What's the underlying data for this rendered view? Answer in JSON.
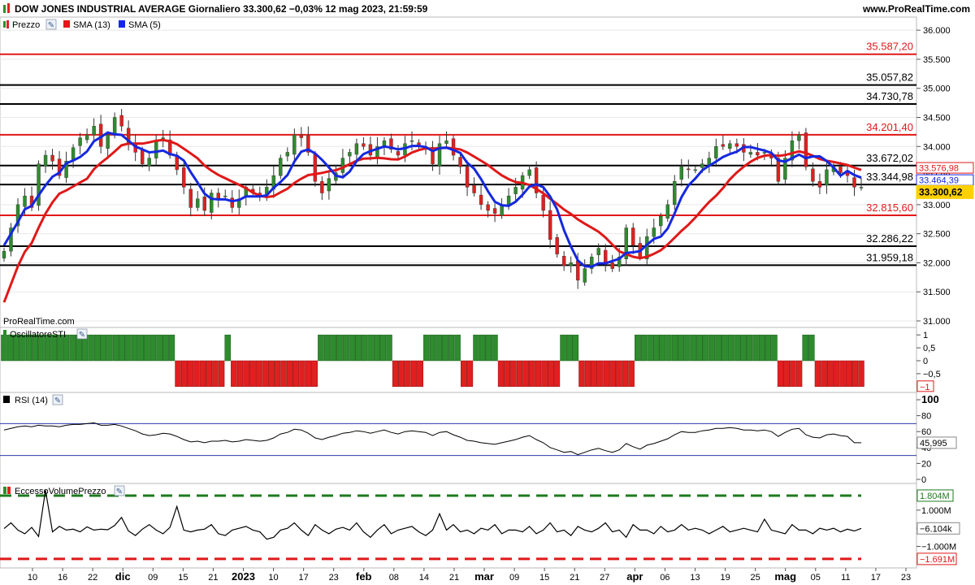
{
  "header": {
    "title": "DOW JONES INDUSTRIAL AVERAGE Giornaliero 33.300,62 −0,03% 12 mag 2023, 21:59:59",
    "site": "www.ProRealTime.com"
  },
  "legend": {
    "price": "Prezzo",
    "sma13": "SMA (13)",
    "sma5": "SMA (5)"
  },
  "watermark": "ProRealTime.com",
  "colors": {
    "up": "#2e8b2e",
    "down": "#e02020",
    "sma13": "#e01818",
    "sma5": "#1428e0",
    "grid": "#e8e8e8"
  },
  "chart_data": [
    {
      "type": "candlestick",
      "name": "price-panel",
      "ylim": [
        31000,
        36100
      ],
      "y_ticks": [
        "36.000",
        "35.500",
        "35.000",
        "34.500",
        "34.000",
        "33.500",
        "33.000",
        "32.500",
        "32.000",
        "31.500",
        "31.000"
      ],
      "y_tick_values": [
        36000,
        35500,
        35000,
        34500,
        34000,
        33500,
        33000,
        32500,
        32000,
        31500,
        31000
      ],
      "x_tick_labels": [
        "10",
        "16",
        "22",
        "dic",
        "09",
        "15",
        "21",
        "2023",
        "10",
        "17",
        "23",
        "feb",
        "08",
        "14",
        "21",
        "mar",
        "09",
        "15",
        "21",
        "27",
        "apr",
        "06",
        "13",
        "19",
        "25",
        "mag",
        "05",
        "11",
        "17",
        "23"
      ],
      "levels": [
        {
          "value": 35587.2,
          "label": "35.587,20",
          "color": "#e01818"
        },
        {
          "value": 35057.82,
          "label": "35.057,82",
          "color": "#000000"
        },
        {
          "value": 34730.78,
          "label": "34.730,78",
          "color": "#000000"
        },
        {
          "value": 34201.4,
          "label": "34.201,40",
          "color": "#e01818"
        },
        {
          "value": 33672.02,
          "label": "33.672,02",
          "color": "#000000"
        },
        {
          "value": 33344.98,
          "label": "33.344,98",
          "color": "#000000"
        },
        {
          "value": 32815.6,
          "label": "32.815,60",
          "color": "#e01818"
        },
        {
          "value": 32286.22,
          "label": "32.286,22",
          "color": "#000000"
        },
        {
          "value": 31959.18,
          "label": "31.959,18",
          "color": "#000000"
        }
      ],
      "badges": [
        {
          "value": 33576.98,
          "label": "33.576,98",
          "kind": "sma13"
        },
        {
          "value": 33464.39,
          "label": "33.464,39",
          "kind": "sma5"
        },
        {
          "value": 33300.62,
          "label": "33.300,62",
          "kind": "last"
        }
      ],
      "close": [
        32200,
        32600,
        33000,
        33150,
        32950,
        33700,
        33850,
        33750,
        33500,
        33750,
        33980,
        34150,
        34200,
        34350,
        34000,
        34200,
        34500,
        34350,
        34050,
        33900,
        33700,
        33800,
        34100,
        34150,
        33850,
        33600,
        33300,
        32950,
        33100,
        32900,
        33200,
        33100,
        33150,
        32950,
        33100,
        33300,
        33200,
        33150,
        33300,
        33500,
        33800,
        33900,
        34200,
        34150,
        33900,
        33400,
        33200,
        33450,
        33550,
        33800,
        33900,
        34050,
        34000,
        33850,
        34000,
        34100,
        33950,
        33850,
        34050,
        34100,
        34000,
        33950,
        33700,
        34050,
        34100,
        33850,
        33650,
        33300,
        33200,
        33000,
        32900,
        32850,
        33000,
        33150,
        33300,
        33500,
        33600,
        33200,
        32900,
        32400,
        32150,
        31950,
        32000,
        31700,
        31900,
        32100,
        32250,
        32000,
        31900,
        32100,
        32600,
        32300,
        32100,
        32450,
        32600,
        32800,
        33000,
        33400,
        33650,
        33600,
        33600,
        33700,
        33800,
        34000,
        34000,
        34050,
        34000,
        33900,
        33900,
        33850,
        33900,
        33800,
        33400,
        33800,
        34100,
        34200,
        33650,
        33400,
        33300,
        33600,
        33650,
        33550,
        33500,
        33300,
        33300
      ],
      "sma5": [
        32300,
        32500,
        32700,
        32920,
        32980,
        33160,
        33330,
        33480,
        33550,
        33710,
        33760,
        33820,
        33915,
        34090,
        34160,
        34240,
        34210,
        34200,
        34100,
        34000,
        33950,
        33900,
        33910,
        33930,
        33870,
        33840,
        33760,
        33560,
        33380,
        33190,
        33100,
        33090,
        33090,
        33060,
        33080,
        33140,
        33140,
        33140,
        33160,
        33290,
        33390,
        33510,
        33740,
        33910,
        33950,
        33880,
        33770,
        33640,
        33500,
        33470,
        33570,
        33750,
        33870,
        33920,
        33960,
        34000,
        33980,
        33950,
        33970,
        34010,
        34010,
        33990,
        33920,
        33970,
        33980,
        33940,
        33890,
        33720,
        33620,
        33440,
        33230,
        33050,
        32990,
        32980,
        33050,
        33170,
        33310,
        33350,
        33300,
        33140,
        32920,
        32560,
        32280,
        32040,
        31940,
        31930,
        31990,
        31990,
        32030,
        32070,
        32170,
        32180,
        32200,
        32310,
        32410,
        32450,
        32590,
        32850,
        33130,
        33330,
        33450,
        33590,
        33670,
        33740,
        33820,
        33870,
        33910,
        33990,
        33990,
        33960,
        33930,
        33890,
        33760,
        33740,
        33800,
        33860,
        33800,
        33830,
        33830,
        33750,
        33640,
        33500,
        33580,
        33510,
        33464
      ]
    },
    {
      "type": "bar",
      "name": "OscillatoreSTI",
      "title": "OscillatoreSTI",
      "ylim": [
        -1.1,
        1.1
      ],
      "y_ticks": [
        "1",
        "0,5",
        "0",
        "−0,5"
      ],
      "y_tick_values": [
        1,
        0.5,
        0,
        -0.5
      ],
      "last_value_label": "−1",
      "values": [
        1,
        1,
        1,
        1,
        1,
        1,
        1,
        1,
        1,
        1,
        1,
        1,
        1,
        1,
        1,
        1,
        1,
        1,
        1,
        1,
        1,
        1,
        1,
        1,
        1,
        1,
        1,
        1,
        -1,
        -1,
        -1,
        -1,
        -1,
        -1,
        -1,
        -1,
        1,
        -1,
        -1,
        -1,
        -1,
        -1,
        -1,
        -1,
        -1,
        -1,
        -1,
        -1,
        -1,
        -1,
        -1,
        1,
        1,
        1,
        1,
        1,
        1,
        1,
        1,
        1,
        1,
        1,
        1,
        -1,
        -1,
        -1,
        -1,
        -1,
        1,
        1,
        1,
        1,
        1,
        1,
        -1,
        -1,
        1,
        1,
        1,
        1,
        -1,
        -1,
        -1,
        -1,
        -1,
        -1,
        -1,
        -1,
        -1,
        -1,
        1,
        1,
        1,
        -1,
        -1,
        -1,
        -1,
        -1,
        -1,
        -1,
        -1,
        -1,
        1,
        1,
        1,
        1,
        1,
        1,
        1,
        1,
        1,
        1,
        1,
        1,
        1,
        1,
        1,
        1,
        1,
        1,
        1,
        1,
        1,
        1,
        1,
        -1,
        -1,
        -1,
        -1,
        1,
        1,
        -1,
        -1,
        -1,
        -1,
        -1,
        -1,
        -1,
        -1
      ]
    },
    {
      "type": "line",
      "name": "RSI",
      "title": "RSI (14)",
      "ylim": [
        0,
        100
      ],
      "y_ticks": [
        "100",
        "80",
        "60",
        "40",
        "20",
        "0"
      ],
      "y_tick_values": [
        100,
        80,
        60,
        40,
        20,
        0
      ],
      "bands": [
        70,
        30
      ],
      "last_value_label": "45,995",
      "values": [
        62,
        64,
        66,
        67,
        66,
        68,
        67,
        67,
        66,
        68,
        69,
        69,
        70,
        71,
        68,
        68,
        69,
        67,
        64,
        61,
        57,
        55,
        56,
        58,
        57,
        54,
        50,
        47,
        48,
        46,
        48,
        48,
        49,
        47,
        48,
        50,
        49,
        48,
        49,
        52,
        57,
        59,
        63,
        62,
        58,
        52,
        50,
        53,
        55,
        58,
        59,
        61,
        60,
        58,
        60,
        62,
        59,
        57,
        60,
        61,
        60,
        59,
        55,
        59,
        60,
        56,
        53,
        49,
        48,
        46,
        45,
        44,
        46,
        48,
        50,
        53,
        55,
        50,
        46,
        40,
        37,
        34,
        35,
        31,
        34,
        37,
        39,
        36,
        34,
        37,
        45,
        41,
        38,
        43,
        45,
        48,
        51,
        56,
        60,
        59,
        59,
        61,
        62,
        64,
        64,
        65,
        64,
        62,
        62,
        61,
        62,
        60,
        54,
        59,
        63,
        64,
        56,
        53,
        52,
        56,
        57,
        55,
        54,
        46,
        46
      ]
    },
    {
      "type": "line",
      "name": "EccessoVolumePrezzo",
      "title": "EccessoVolumePrezzo",
      "ylim": [
        -2100000,
        2250000
      ],
      "y_ticks": [
        "1.000M",
        "0",
        "−1.000M"
      ],
      "y_tick_values": [
        1000000,
        0,
        -1000000
      ],
      "upper_level": 1804000,
      "upper_label": "1.804M",
      "lower_level": -1691000,
      "lower_label": "−1.691M",
      "last_value_label": "−6.104k",
      "values": [
        -20000,
        300000,
        -100000,
        -300000,
        50000,
        -450000,
        2100000,
        -200000,
        100000,
        -100000,
        -50000,
        -200000,
        80000,
        -100000,
        -50000,
        -80000,
        150000,
        600000,
        -150000,
        -400000,
        -50000,
        200000,
        -100000,
        -300000,
        50000,
        1200000,
        -100000,
        -200000,
        -100000,
        -50000,
        200000,
        -300000,
        -400000,
        -100000,
        0,
        100000,
        -100000,
        -200000,
        -600000,
        -500000,
        -100000,
        0,
        300000,
        -100000,
        -400000,
        200000,
        -100000,
        -300000,
        -50000,
        50000,
        -100000,
        300000,
        -200000,
        -500000,
        -100000,
        200000,
        -300000,
        -100000,
        0,
        100000,
        -200000,
        -400000,
        -100000,
        800000,
        -100000,
        200000,
        -200000,
        -100000,
        -300000,
        0,
        -100000,
        200000,
        -300000,
        -100000,
        -100000,
        -200000,
        100000,
        -300000,
        -100000,
        300000,
        -200000,
        -100000,
        -400000,
        100000,
        -100000,
        -200000,
        0,
        300000,
        -200000,
        -100000,
        -500000,
        200000,
        -100000,
        -100000,
        -300000,
        100000,
        -200000,
        -100000,
        200000,
        -100000,
        0,
        -100000,
        -300000,
        -100000,
        100000,
        -200000,
        -100000,
        0,
        -100000,
        -200000,
        500000,
        -100000,
        -200000,
        -300000,
        200000,
        -100000,
        -100000,
        -300000,
        0,
        -100000,
        0,
        -200000,
        -50000,
        -150000,
        -6104
      ]
    }
  ]
}
